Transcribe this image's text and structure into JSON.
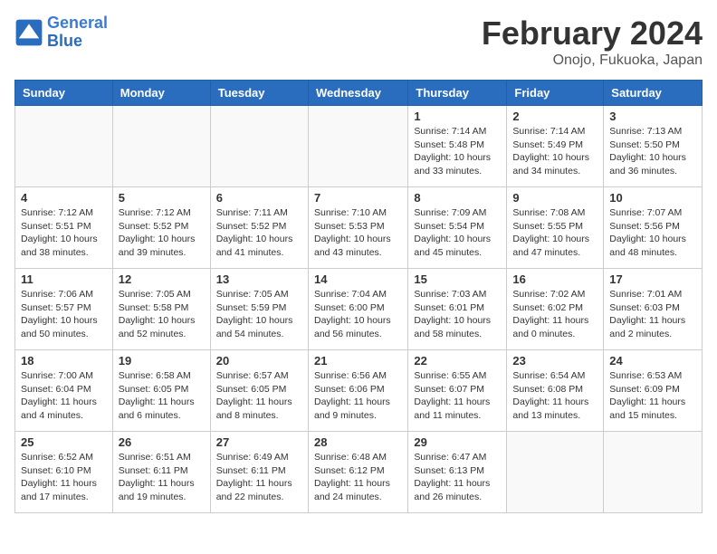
{
  "header": {
    "logo_line1": "General",
    "logo_line2": "Blue",
    "month_year": "February 2024",
    "location": "Onojo, Fukuoka, Japan"
  },
  "weekdays": [
    "Sunday",
    "Monday",
    "Tuesday",
    "Wednesday",
    "Thursday",
    "Friday",
    "Saturday"
  ],
  "weeks": [
    [
      {
        "day": "",
        "info": ""
      },
      {
        "day": "",
        "info": ""
      },
      {
        "day": "",
        "info": ""
      },
      {
        "day": "",
        "info": ""
      },
      {
        "day": "1",
        "info": "Sunrise: 7:14 AM\nSunset: 5:48 PM\nDaylight: 10 hours\nand 33 minutes."
      },
      {
        "day": "2",
        "info": "Sunrise: 7:14 AM\nSunset: 5:49 PM\nDaylight: 10 hours\nand 34 minutes."
      },
      {
        "day": "3",
        "info": "Sunrise: 7:13 AM\nSunset: 5:50 PM\nDaylight: 10 hours\nand 36 minutes."
      }
    ],
    [
      {
        "day": "4",
        "info": "Sunrise: 7:12 AM\nSunset: 5:51 PM\nDaylight: 10 hours\nand 38 minutes."
      },
      {
        "day": "5",
        "info": "Sunrise: 7:12 AM\nSunset: 5:52 PM\nDaylight: 10 hours\nand 39 minutes."
      },
      {
        "day": "6",
        "info": "Sunrise: 7:11 AM\nSunset: 5:52 PM\nDaylight: 10 hours\nand 41 minutes."
      },
      {
        "day": "7",
        "info": "Sunrise: 7:10 AM\nSunset: 5:53 PM\nDaylight: 10 hours\nand 43 minutes."
      },
      {
        "day": "8",
        "info": "Sunrise: 7:09 AM\nSunset: 5:54 PM\nDaylight: 10 hours\nand 45 minutes."
      },
      {
        "day": "9",
        "info": "Sunrise: 7:08 AM\nSunset: 5:55 PM\nDaylight: 10 hours\nand 47 minutes."
      },
      {
        "day": "10",
        "info": "Sunrise: 7:07 AM\nSunset: 5:56 PM\nDaylight: 10 hours\nand 48 minutes."
      }
    ],
    [
      {
        "day": "11",
        "info": "Sunrise: 7:06 AM\nSunset: 5:57 PM\nDaylight: 10 hours\nand 50 minutes."
      },
      {
        "day": "12",
        "info": "Sunrise: 7:05 AM\nSunset: 5:58 PM\nDaylight: 10 hours\nand 52 minutes."
      },
      {
        "day": "13",
        "info": "Sunrise: 7:05 AM\nSunset: 5:59 PM\nDaylight: 10 hours\nand 54 minutes."
      },
      {
        "day": "14",
        "info": "Sunrise: 7:04 AM\nSunset: 6:00 PM\nDaylight: 10 hours\nand 56 minutes."
      },
      {
        "day": "15",
        "info": "Sunrise: 7:03 AM\nSunset: 6:01 PM\nDaylight: 10 hours\nand 58 minutes."
      },
      {
        "day": "16",
        "info": "Sunrise: 7:02 AM\nSunset: 6:02 PM\nDaylight: 11 hours\nand 0 minutes."
      },
      {
        "day": "17",
        "info": "Sunrise: 7:01 AM\nSunset: 6:03 PM\nDaylight: 11 hours\nand 2 minutes."
      }
    ],
    [
      {
        "day": "18",
        "info": "Sunrise: 7:00 AM\nSunset: 6:04 PM\nDaylight: 11 hours\nand 4 minutes."
      },
      {
        "day": "19",
        "info": "Sunrise: 6:58 AM\nSunset: 6:05 PM\nDaylight: 11 hours\nand 6 minutes."
      },
      {
        "day": "20",
        "info": "Sunrise: 6:57 AM\nSunset: 6:05 PM\nDaylight: 11 hours\nand 8 minutes."
      },
      {
        "day": "21",
        "info": "Sunrise: 6:56 AM\nSunset: 6:06 PM\nDaylight: 11 hours\nand 9 minutes."
      },
      {
        "day": "22",
        "info": "Sunrise: 6:55 AM\nSunset: 6:07 PM\nDaylight: 11 hours\nand 11 minutes."
      },
      {
        "day": "23",
        "info": "Sunrise: 6:54 AM\nSunset: 6:08 PM\nDaylight: 11 hours\nand 13 minutes."
      },
      {
        "day": "24",
        "info": "Sunrise: 6:53 AM\nSunset: 6:09 PM\nDaylight: 11 hours\nand 15 minutes."
      }
    ],
    [
      {
        "day": "25",
        "info": "Sunrise: 6:52 AM\nSunset: 6:10 PM\nDaylight: 11 hours\nand 17 minutes."
      },
      {
        "day": "26",
        "info": "Sunrise: 6:51 AM\nSunset: 6:11 PM\nDaylight: 11 hours\nand 19 minutes."
      },
      {
        "day": "27",
        "info": "Sunrise: 6:49 AM\nSunset: 6:11 PM\nDaylight: 11 hours\nand 22 minutes."
      },
      {
        "day": "28",
        "info": "Sunrise: 6:48 AM\nSunset: 6:12 PM\nDaylight: 11 hours\nand 24 minutes."
      },
      {
        "day": "29",
        "info": "Sunrise: 6:47 AM\nSunset: 6:13 PM\nDaylight: 11 hours\nand 26 minutes."
      },
      {
        "day": "",
        "info": ""
      },
      {
        "day": "",
        "info": ""
      }
    ]
  ]
}
